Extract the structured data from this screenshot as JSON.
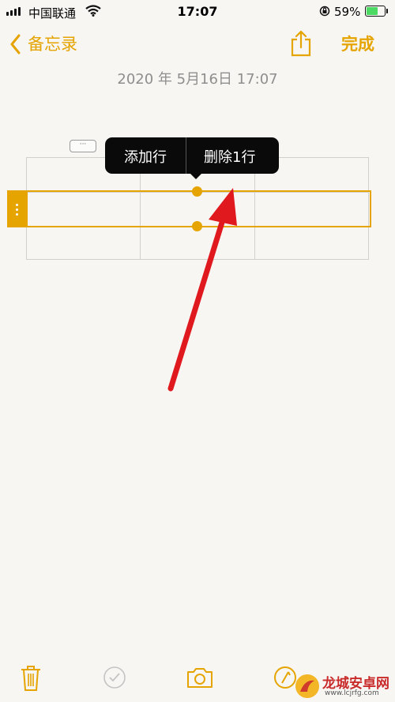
{
  "status_bar": {
    "carrier": "中国联通",
    "time": "17:07",
    "battery": "59%"
  },
  "nav": {
    "back_label": "备忘录",
    "done_label": "完成"
  },
  "note": {
    "date": "2020 年 5月16日 17:07"
  },
  "table_menu": {
    "add_row": "添加行",
    "delete_row": "删除1行",
    "more": "···"
  },
  "colors": {
    "accent": "#e5a400",
    "arrow": "#e0191e"
  },
  "toolbar": {
    "icons": [
      "trash-icon",
      "checklist-icon",
      "camera-icon",
      "markup-icon"
    ]
  },
  "watermark": {
    "text": "龙城安卓网",
    "url": "www.lcjrfg.com"
  }
}
